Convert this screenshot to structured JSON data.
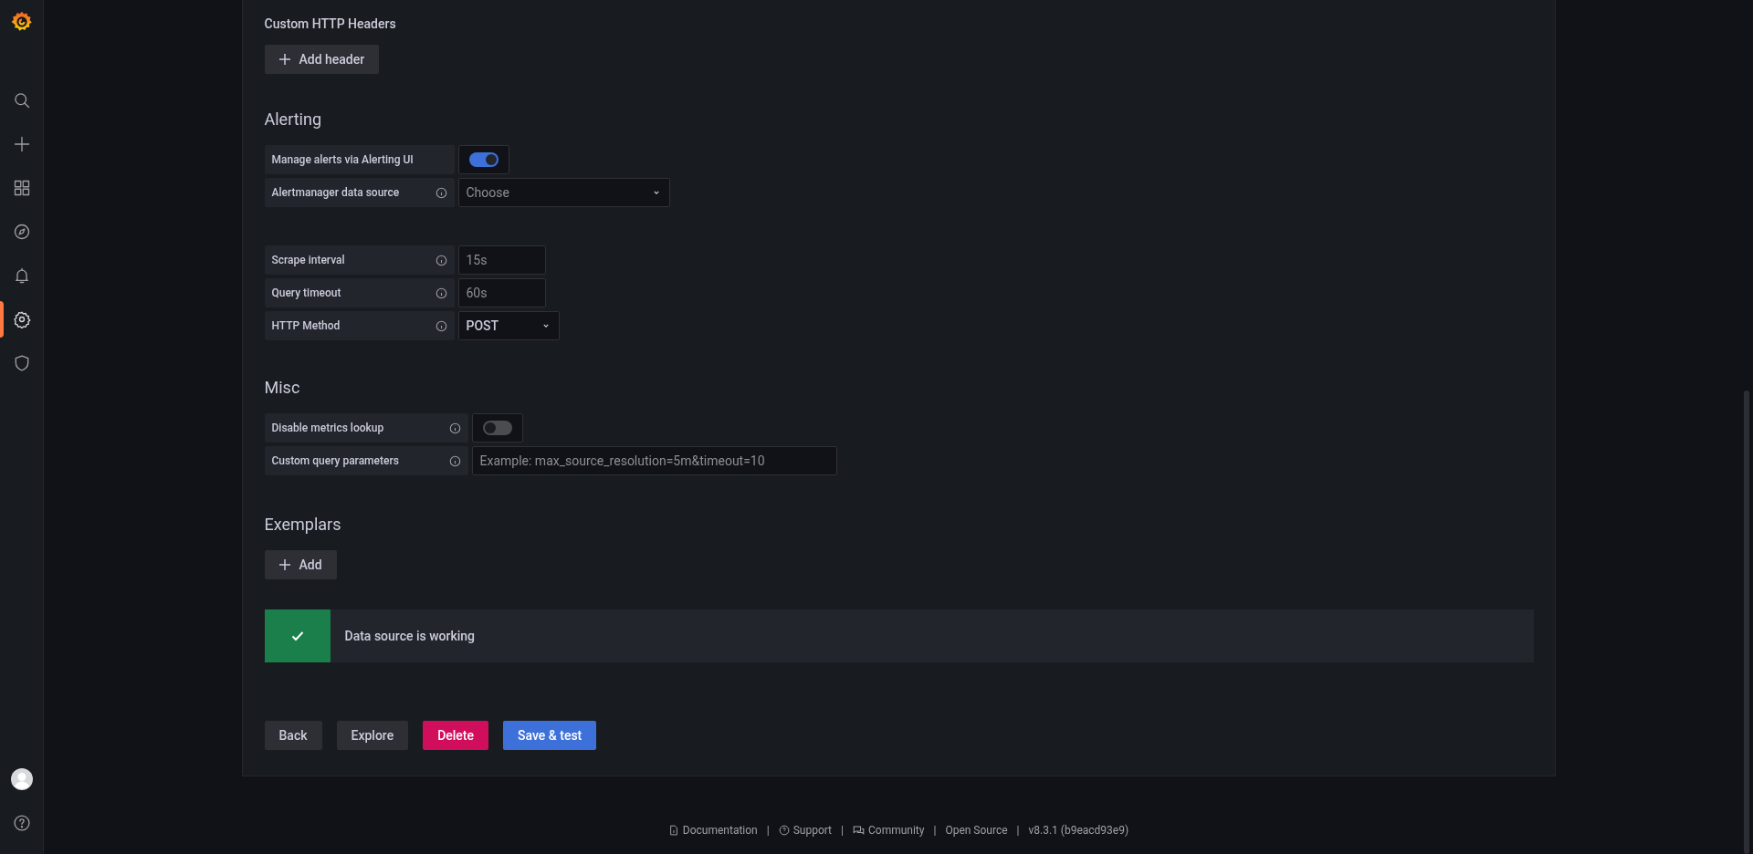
{
  "sidebar": {
    "items": [
      {
        "kind": "search",
        "selected": false
      },
      {
        "kind": "create",
        "selected": false
      },
      {
        "kind": "dashboards",
        "selected": false
      },
      {
        "kind": "explore",
        "selected": false
      },
      {
        "kind": "alerting",
        "selected": false
      },
      {
        "kind": "configuration",
        "selected": true
      },
      {
        "kind": "admin",
        "selected": false
      }
    ],
    "bottom_items": [
      {
        "kind": "profile"
      },
      {
        "kind": "help"
      }
    ]
  },
  "headers_section": {
    "title": "Custom HTTP Headers",
    "add_button": "Add header"
  },
  "alerting": {
    "title": "Alerting",
    "fields": [
      {
        "kind": "toggle",
        "label": "Manage alerts via Alerting UI",
        "info": false,
        "on": true
      },
      {
        "kind": "select",
        "label": "Alertmanager data source",
        "info": true,
        "placeholder": "Choose"
      }
    ]
  },
  "query_fields": [
    {
      "kind": "input",
      "label": "Scrape interval",
      "info": true,
      "placeholder": "15s"
    },
    {
      "kind": "input",
      "label": "Query timeout",
      "info": true,
      "placeholder": "60s"
    },
    {
      "kind": "select",
      "label": "HTTP Method",
      "info": true,
      "value": "POST"
    }
  ],
  "misc": {
    "title": "Misc",
    "fields": [
      {
        "kind": "toggle",
        "label": "Disable metrics lookup",
        "info": true,
        "on": false
      },
      {
        "kind": "input",
        "label": "Custom query parameters",
        "info": true,
        "placeholder": "Example: max_source_resolution=5m&timeout=10"
      }
    ]
  },
  "exemplars": {
    "title": "Exemplars",
    "add_button": "Add"
  },
  "status": {
    "kind": "success",
    "message": "Data source is working"
  },
  "actions": [
    {
      "kind": "secondary",
      "label": "Back"
    },
    {
      "kind": "secondary",
      "label": "Explore"
    },
    {
      "kind": "destructive",
      "label": "Delete"
    },
    {
      "kind": "primary",
      "label": "Save & test"
    }
  ],
  "footer": [
    {
      "kind": "docs",
      "label": "Documentation"
    },
    {
      "kind": "separator",
      "label": "|"
    },
    {
      "kind": "support",
      "label": "Support"
    },
    {
      "kind": "separator",
      "label": "|"
    },
    {
      "kind": "community",
      "label": "Community"
    },
    {
      "kind": "separator",
      "label": "|"
    },
    {
      "kind": "link",
      "label": "Open Source"
    },
    {
      "kind": "separator",
      "label": "|"
    },
    {
      "kind": "version",
      "label": "v8.3.1 (b9eacd93e9)"
    }
  ]
}
